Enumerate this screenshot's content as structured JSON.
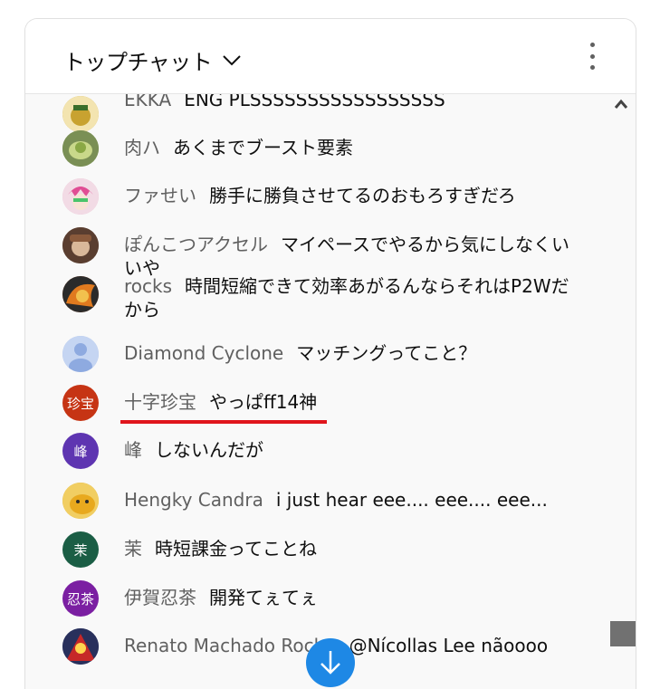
{
  "header": {
    "title": "トップチャット"
  },
  "messages": [
    {
      "author": "EKKA",
      "text": "ENG PLSSSSSSSSSSSSSSSSS",
      "avatar_color": "#c8a230"
    },
    {
      "author": "肉ハ",
      "text": "あくまでブースト要素",
      "avatar_color": "#6f8f3c"
    },
    {
      "author": "ファせい",
      "text": "勝手に勝負させてるのおもろすぎだろ",
      "avatar_color": "#e8b4c8"
    },
    {
      "author": "ぽんこつアクセル",
      "text": "マイペースでやるから気にしなくいいや",
      "avatar_color": "#6b4a3a"
    },
    {
      "author": "rocks",
      "text": "時間短縮できて効率あがるんならそれはP2Wだから",
      "avatar_color": "#c4561c"
    },
    {
      "author": "Diamond Cyclone",
      "text": "マッチングってこと？",
      "avatar_color": "#9fb7e8"
    },
    {
      "author": "十字珍宝",
      "text": "やっぱff14神",
      "avatar_text": "珍宝",
      "avatar_color": "#c63414"
    },
    {
      "author": "峰",
      "text": "しないんだが",
      "avatar_text": "峰",
      "avatar_color": "#5e35b1"
    },
    {
      "author": "Hengky Candra",
      "text": "i just hear eee.... eee.... eee...",
      "avatar_color": "#d8a520"
    },
    {
      "author": "茉",
      "text": "時短課金ってことね",
      "avatar_text": "茉",
      "avatar_color": "#1b5e45"
    },
    {
      "author": "伊賀忍茶",
      "text": "開発てぇてぇ",
      "avatar_text": "忍茶",
      "avatar_color": "#7b1fa2"
    },
    {
      "author": "Renato Machado Rocha",
      "text": "@Nícollas Lee nãoooo",
      "avatar_color": "#3a3f6b"
    }
  ]
}
